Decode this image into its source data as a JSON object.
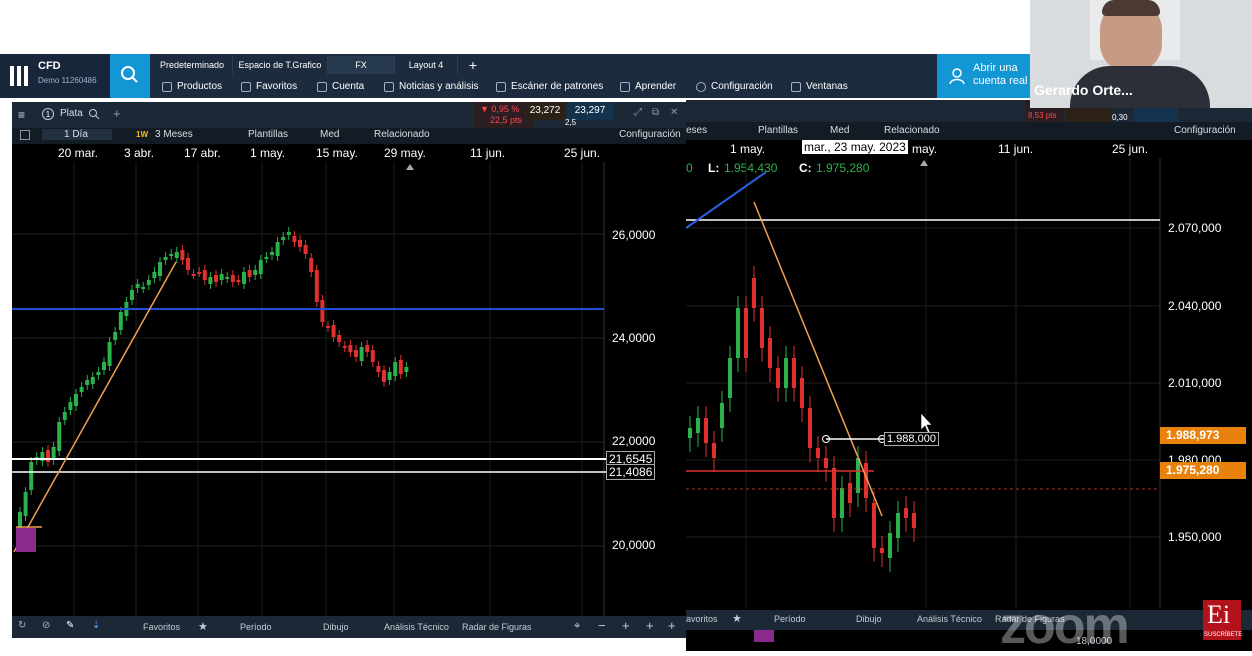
{
  "app": {
    "title": "CFD",
    "subtitle": "Demo 11260486"
  },
  "layout_tabs": [
    "Predeterminado",
    "Espacio de T.Grafico",
    "FX",
    "Layout 4"
  ],
  "add_tab": "+",
  "menu": [
    "Productos",
    "Favoritos",
    "Cuenta",
    "Noticias y análisis",
    "Escáner de patrones",
    "Aprender",
    "Configuración",
    "Ventanas"
  ],
  "cta": "Abrir una cuenta real",
  "webcam": {
    "name": "Gerardo Orte..."
  },
  "left_chart": {
    "instrument": "Plata",
    "change_pct": "▼ 0,95 %",
    "change_pts": "22,5 pts",
    "bid": "23,272",
    "ask": "23,297",
    "spread": "2,5",
    "interval": "1 Día",
    "range_badge": "1W",
    "range": "3 Meses",
    "toolbar": [
      "Plantillas",
      "Med",
      "Relacionado"
    ],
    "config": "Configuración",
    "dates": [
      "20 mar.",
      "3 abr.",
      "17 abr.",
      "1 may.",
      "15 may.",
      "29 may.",
      "11 jun.",
      "25 jun."
    ],
    "price_ticks": [
      "26,0000",
      "24,0000",
      "22,0000",
      "20,0000"
    ],
    "level_labels": [
      "21,6545",
      "21,4086"
    ],
    "bottom_tabs": [
      "Favoritos",
      "Período",
      "Dibujo",
      "Análisis Técnico",
      "Radar de Figuras"
    ]
  },
  "right_chart": {
    "range_partial": "eses",
    "change_pts": "8,53 pts",
    "spread": "0,30",
    "toolbar": [
      "Plantillas",
      "Med",
      "Relacionado"
    ],
    "config": "Configuración",
    "dates": [
      "1 may.",
      "may.",
      "11 jun.",
      "25 jun."
    ],
    "tooltip_date": "mar., 23 may. 2023",
    "ohlc": {
      "partial": "0",
      "l_label": "L:",
      "l_value": "1.954,430",
      "c_label": "C:",
      "c_value": "1.975,280"
    },
    "price_ticks": [
      "2.070,000",
      "2.040,000",
      "2.010,000",
      "1.980,000",
      "1.950,000"
    ],
    "price_tags": [
      "1.988,973",
      "1.975,280"
    ],
    "measure_label": "1.988,000",
    "bottom_tabs": [
      "avoritos",
      "Período",
      "Dibujo",
      "Análisis Técnico",
      "Radar de Figuras"
    ],
    "lower_tick": "18,0000"
  },
  "watermark": "zoom",
  "ei_logo": {
    "letters": "Ei",
    "caption": "SUSCRÍBETE"
  },
  "colors": {
    "up": "#2bb24c",
    "down": "#e0312e",
    "trend": "#f0a050",
    "hline_blue": "#1f4fd8",
    "hline_white": "#ffffff",
    "accent": "#1296d4",
    "tag_orange": "#e8820c"
  }
}
